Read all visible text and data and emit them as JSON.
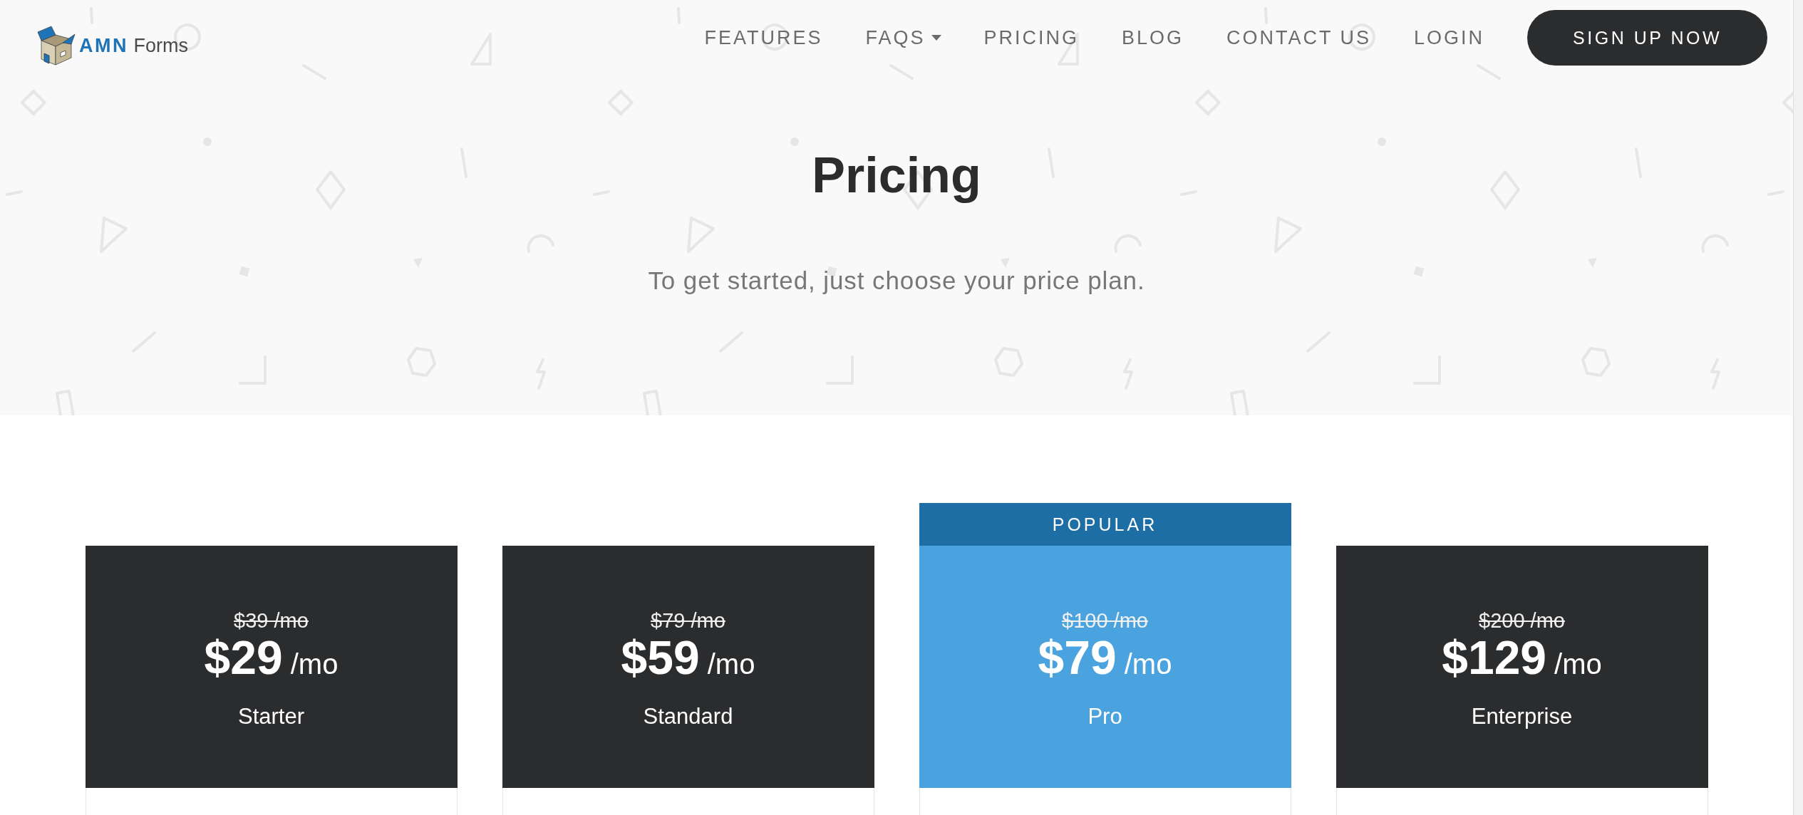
{
  "logo": {
    "text": "**AMN** Forms"
  },
  "nav": {
    "items": [
      {
        "label": "FEATURES",
        "dropdown": false
      },
      {
        "label": "FAQS",
        "dropdown": true
      },
      {
        "label": "PRICING",
        "dropdown": false
      },
      {
        "label": "BLOG",
        "dropdown": false
      },
      {
        "label": "CONTACT US",
        "dropdown": false
      },
      {
        "label": "LOGIN",
        "dropdown": false
      }
    ],
    "cta": "SIGN UP NOW"
  },
  "hero": {
    "title": "Pricing",
    "subtitle": "To get started, just choose your price plan."
  },
  "plans": [
    {
      "old_price": "$39 /mo",
      "price": "$29",
      "period": "/mo",
      "name": "Starter",
      "popular": false
    },
    {
      "old_price": "$79 /mo",
      "price": "$59",
      "period": "/mo",
      "name": "Standard",
      "popular": false
    },
    {
      "badge": "POPULAR",
      "old_price": "$100 /mo",
      "price": "$79",
      "period": "/mo",
      "name": "Pro",
      "popular": true
    },
    {
      "old_price": "$200 /mo",
      "price": "$129",
      "period": "/mo",
      "name": "Enterprise",
      "popular": false
    }
  ]
}
